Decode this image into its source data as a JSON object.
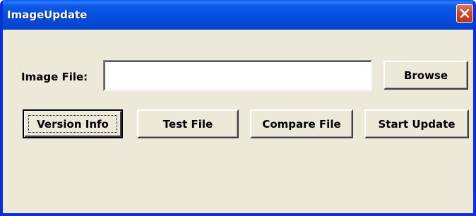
{
  "window": {
    "title": "ImageUpdate",
    "close_icon": "close-icon"
  },
  "form": {
    "image_file_label": "Image File:",
    "image_file_value": "",
    "browse_label": "Browse"
  },
  "actions": {
    "version_info_label": "Version Info",
    "test_file_label": "Test File",
    "compare_file_label": "Compare File",
    "start_update_label": "Start Update"
  },
  "colors": {
    "titlebar": "#0550e0",
    "window_bg": "#ece9d8",
    "close_button": "#d4462a"
  }
}
